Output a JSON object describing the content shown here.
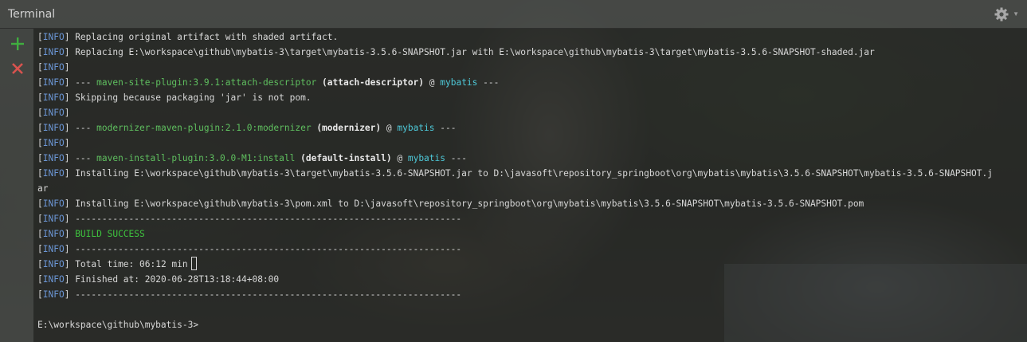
{
  "window": {
    "title": "Terminal",
    "accent": "#6b96d6"
  },
  "toolbar": {
    "add_icon": "plus-icon",
    "close_icon": "close-icon",
    "settings_icon": "gear-icon"
  },
  "colors": {
    "info_tag": "#6b96d6",
    "plugin": "#5fbf5f",
    "success": "#3ec43e",
    "project": "#4ec9d9",
    "add": "#3fae3f",
    "close": "#d9534f"
  },
  "terminal": {
    "tag_text": "INFO",
    "lines": [
      {
        "kind": "plain",
        "text": "Replacing original artifact with shaded artifact."
      },
      {
        "kind": "plain",
        "text": "Replacing E:\\workspace\\github\\mybatis-3\\target\\mybatis-3.5.6-SNAPSHOT.jar with E:\\workspace\\github\\mybatis-3\\target\\mybatis-3.5.6-SNAPSHOT-shaded.jar"
      },
      {
        "kind": "plain",
        "text": ""
      },
      {
        "kind": "plugin",
        "prefix": "--- ",
        "plugin": "maven-site-plugin:3.9.1:attach-descriptor",
        "exec": "(attach-descriptor)",
        "at": " @ ",
        "project": "mybatis",
        "suffix": " ---"
      },
      {
        "kind": "plain",
        "text": "Skipping because packaging 'jar' is not pom."
      },
      {
        "kind": "plain",
        "text": ""
      },
      {
        "kind": "plugin",
        "prefix": "--- ",
        "plugin": "modernizer-maven-plugin:2.1.0:modernizer",
        "exec": "(modernizer)",
        "at": " @ ",
        "project": "mybatis",
        "suffix": " ---"
      },
      {
        "kind": "plain",
        "text": ""
      },
      {
        "kind": "plugin",
        "prefix": "--- ",
        "plugin": "maven-install-plugin:3.0.0-M1:install",
        "exec": "(default-install)",
        "at": " @ ",
        "project": "mybatis",
        "suffix": " ---"
      },
      {
        "kind": "plain",
        "text": "Installing E:\\workspace\\github\\mybatis-3\\target\\mybatis-3.5.6-SNAPSHOT.jar to D:\\javasoft\\repository_springboot\\org\\mybatis\\mybatis\\3.5.6-SNAPSHOT\\mybatis-3.5.6-SNAPSHOT.j"
      },
      {
        "kind": "wrap",
        "text": "ar"
      },
      {
        "kind": "plain",
        "text": "Installing E:\\workspace\\github\\mybatis-3\\pom.xml to D:\\javasoft\\repository_springboot\\org\\mybatis\\mybatis\\3.5.6-SNAPSHOT\\mybatis-3.5.6-SNAPSHOT.pom"
      },
      {
        "kind": "plain",
        "text": "------------------------------------------------------------------------"
      },
      {
        "kind": "success",
        "text": "BUILD SUCCESS"
      },
      {
        "kind": "plain",
        "text": "------------------------------------------------------------------------"
      },
      {
        "kind": "cursor",
        "text": "Total time: 06:12 min"
      },
      {
        "kind": "plain",
        "text": "Finished at: 2020-06-28T13:18:44+08:00"
      },
      {
        "kind": "plain",
        "text": "------------------------------------------------------------------------"
      },
      {
        "kind": "wrap",
        "text": ""
      },
      {
        "kind": "wrap",
        "text": "E:\\workspace\\github\\mybatis-3>"
      }
    ]
  }
}
